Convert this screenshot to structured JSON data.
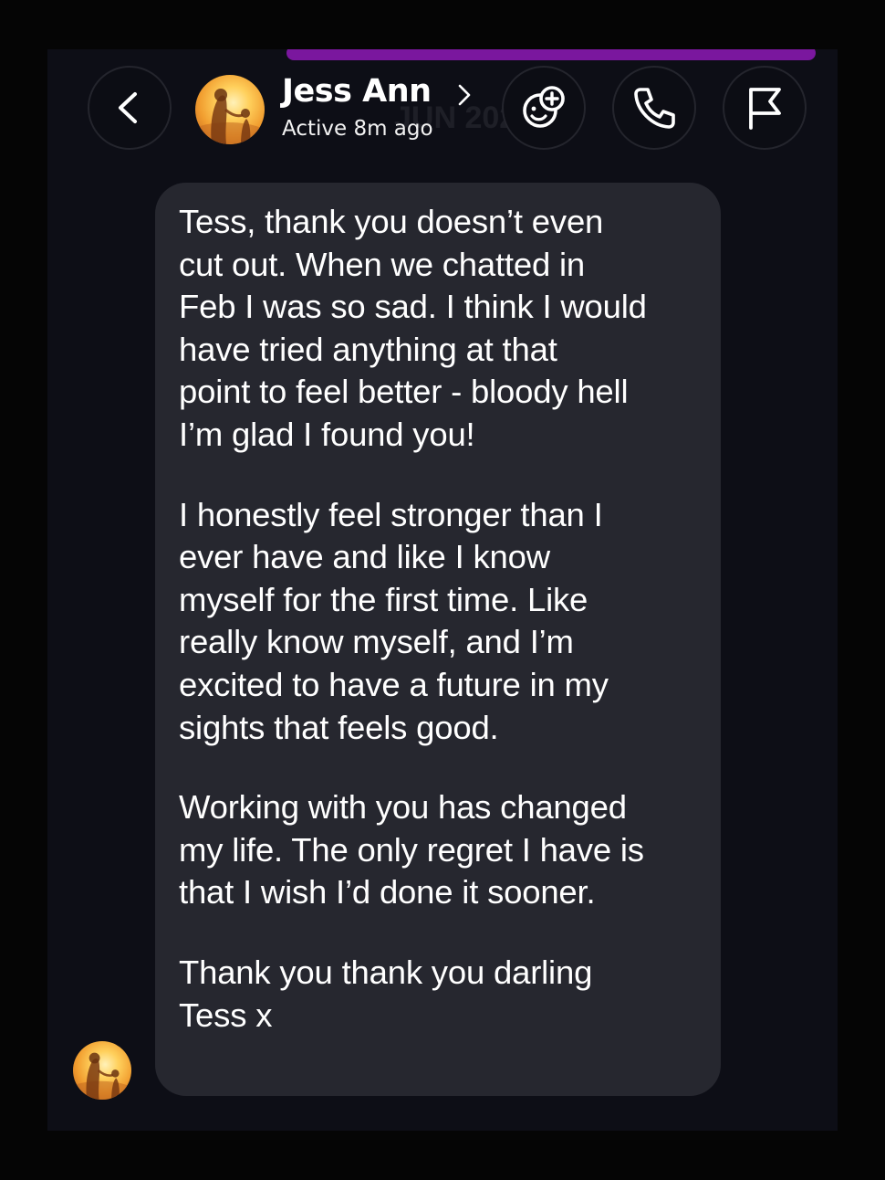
{
  "header": {
    "contact_name": "Jess Ann",
    "status": "Active 8m ago",
    "faded_background_text": "JUN 202",
    "icons": {
      "back": "chevron-left-icon",
      "name_chevron": "chevron-right-icon",
      "effects": "add-effect-icon",
      "call": "phone-icon",
      "report": "flag-icon"
    }
  },
  "message": {
    "sender": "Jess Ann",
    "paragraphs": [
      "Tess, thank you doesn’t even\ncut out. When we chatted in\nFeb I was so sad. I think I would\nhave tried anything at that\npoint to feel better - bloody hell\nI’m glad I found you!",
      "I honestly feel stronger than I\never have and like I know\nmyself for the first time. Like\nreally know myself, and I’m\nexcited to have a future in my\nsights that feels good.",
      "Working with you has changed\nmy life. The only regret I have is\nthat I wish I’d done it sooner.",
      "Thank you thank you darling\nTess x"
    ]
  },
  "colors": {
    "background": "#0d0e16",
    "bubble": "#26272f",
    "text": "#ffffff",
    "accent_bar": "#8e19b6",
    "button_border": "#24252d"
  }
}
